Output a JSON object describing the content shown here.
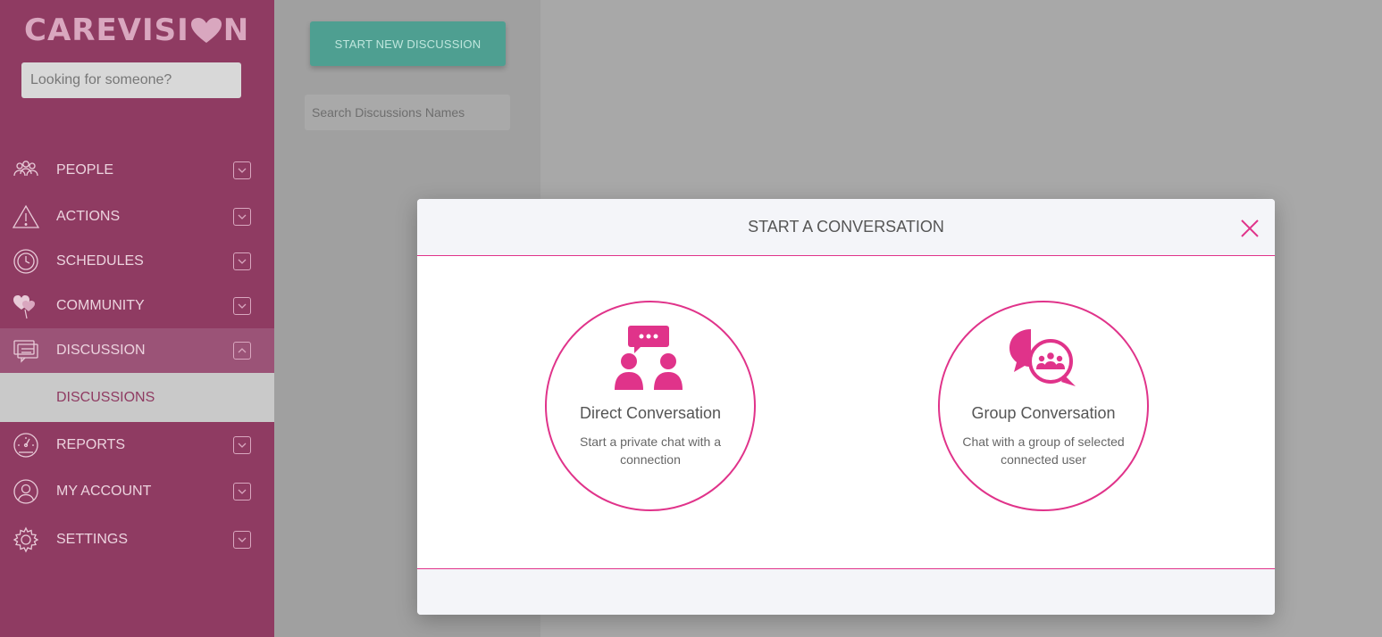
{
  "brand": {
    "logo_left": "CAREVISI",
    "logo_right": "N",
    "color": "#d9a7bf"
  },
  "sidebar": {
    "search_placeholder": "Looking for someone?",
    "items": [
      {
        "label": "PEOPLE",
        "icon": "people-icon"
      },
      {
        "label": "ACTIONS",
        "icon": "warning-icon"
      },
      {
        "label": "SCHEDULES",
        "icon": "clock-icon"
      },
      {
        "label": "COMMUNITY",
        "icon": "hearts-icon"
      },
      {
        "label": "DISCUSSION",
        "icon": "chat-icon",
        "expanded": true
      },
      {
        "label": "REPORTS",
        "icon": "gauge-icon"
      },
      {
        "label": "MY ACCOUNT",
        "icon": "user-icon"
      },
      {
        "label": "SETTINGS",
        "icon": "gear-icon"
      }
    ],
    "sub_item": "DISCUSSIONS"
  },
  "discussions": {
    "new_button": "START NEW DISCUSSION",
    "search_placeholder": "Search Discussions Names"
  },
  "modal": {
    "title": "START A CONVERSATION",
    "accent_color": "#e0338a",
    "options": [
      {
        "title": "Direct Conversation",
        "description": "Start a private chat with a connection"
      },
      {
        "title": "Group Conversation",
        "description": "Chat with a group of selected connected user"
      }
    ]
  }
}
